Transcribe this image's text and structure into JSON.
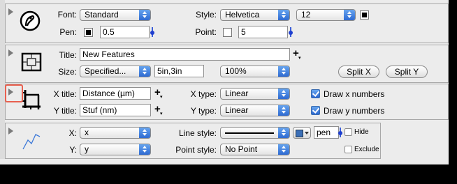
{
  "font_panel": {
    "font_label": "Font:",
    "font_value": "Standard",
    "style_label": "Style:",
    "style_value": "Helvetica",
    "size_value": "12",
    "pen_label": "Pen:",
    "pen_value": "0.5",
    "point_label": "Point:",
    "point_value": "5"
  },
  "title_panel": {
    "title_label": "Title:",
    "title_value": "New Features",
    "size_label": "Size:",
    "size_mode": "Specified...",
    "size_value": "5in,3in",
    "zoom_value": "100%",
    "split_x_label": "Split X",
    "split_y_label": "Split Y"
  },
  "axes_panel": {
    "x_title_label": "X title:",
    "x_title_value": "Distance (µm)",
    "y_title_label": "Y title:",
    "y_title_value": "Stuf (nm)",
    "x_type_label": "X type:",
    "x_type_value": "Linear",
    "y_type_label": "Y type:",
    "y_type_value": "Linear",
    "draw_x_label": "Draw x numbers",
    "draw_x_checked": true,
    "draw_y_label": "Draw y numbers",
    "draw_y_checked": true
  },
  "plot_panel": {
    "x_label": "X:",
    "x_value": "x",
    "y_label": "Y:",
    "y_value": "y",
    "line_style_label": "Line style:",
    "point_style_label": "Point style:",
    "point_style_value": "No Point",
    "pen_value": "pen",
    "hide_label": "Hide",
    "exclude_label": "Exclude"
  },
  "colors": {
    "accent": "#2a66d0",
    "highlight": "#e8604f",
    "line_color": "#3b6fb7"
  }
}
